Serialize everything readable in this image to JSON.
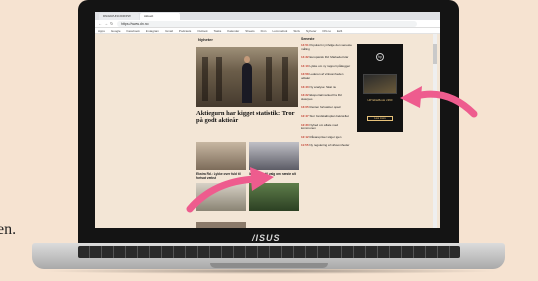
{
  "background_text": "en.",
  "browser": {
    "tabs": [
      {
        "label": "DN/HR/UNC/DR/PW Netcom"
      },
      {
        "label": "Aktuelt"
      }
    ],
    "url": "https://www.dn.no",
    "bookmarks": [
      "Apps",
      "Google",
      "Facebook",
      "Instagram",
      "Gmail",
      "Podcasts",
      "Outlook",
      "Tasks",
      "Kalender",
      "Sheets",
      "Finn",
      "Lommebok",
      "Skriv",
      "Nyheter",
      "DN.no",
      "E24"
    ]
  },
  "page": {
    "logo": "Nyheter",
    "headline": "Aktiegurn har kigget statistik: Tror på godt aktieår",
    "captions": [
      "Ekstra Rd.: Lykke over fuld til fortsat vækst",
      "Ind oplæg til valg om næste alt formål"
    ],
    "sidebar": {
      "heading": "Seneste",
      "items": [
        {
          "time": "14:51",
          "text": "Populært nyt ifølge den seneste måling"
        },
        {
          "time": "14:32",
          "text": "Europæisk Rd: Markedet klar"
        },
        {
          "time": "14:10",
          "text": "Lykke om ny rapport pålægger"
        },
        {
          "time": "13:58",
          "text": "Lederen af virksomheden udtaler"
        },
        {
          "time": "13:40",
          "text": "Ny analyse: Skat nu"
        },
        {
          "time": "13:22",
          "text": "Eksportørmarked fra Rd skærpes"
        },
        {
          "time": "13:05",
          "text": "Renten fortsætter opad"
        },
        {
          "time": "12:47",
          "text": "Stor fondskøbsplan bekræftet"
        },
        {
          "time": "12:30",
          "text": "Nyhed om aftale med kommunen"
        },
        {
          "time": "12:12",
          "text": "Råvarepriser stiger igen"
        },
        {
          "time": "11:55",
          "text": "Ny regulering af virksomheder"
        }
      ]
    },
    "ad": {
      "brand": "hp",
      "text": "HP EliteBook x360",
      "button": "Læs mere"
    }
  },
  "device": {
    "brand": "/ISUS"
  },
  "colors": {
    "arrow": "#ee5c8e",
    "ad_gold": "#e7c27a",
    "page_bg": "#f3e6d6"
  }
}
